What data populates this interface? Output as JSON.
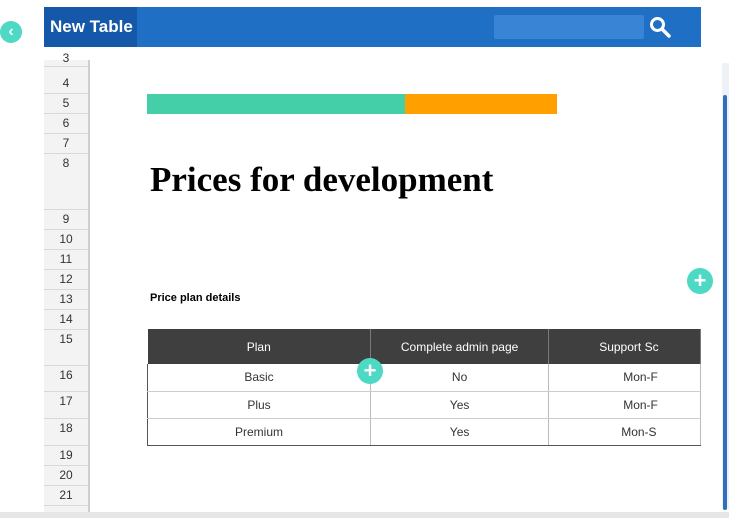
{
  "app": {
    "title": "New Table"
  },
  "search": {
    "placeholder": ""
  },
  "rows": [
    "3",
    "4",
    "5",
    "6",
    "7",
    "8",
    "9",
    "10",
    "11",
    "12",
    "13",
    "14",
    "15",
    "16",
    "17",
    "18",
    "19",
    "20",
    "21"
  ],
  "document": {
    "title": "Prices for development",
    "subtitle": "Price plan details",
    "accent_colors": {
      "green": "#45cfa9",
      "orange": "#ffa000",
      "header": "#1f6fc5"
    }
  },
  "table": {
    "headers": [
      "Plan",
      "Complete admin page",
      "Support Sc"
    ],
    "rows": [
      [
        "Basic",
        "No",
        "Mon-F"
      ],
      [
        "Plus",
        "Yes",
        "Mon-F"
      ],
      [
        "Premium",
        "Yes",
        "Mon-S"
      ]
    ]
  },
  "icons": {
    "back": "chevron-left-icon",
    "search": "search-icon",
    "add": "plus-icon"
  },
  "labels": {
    "plus": "+",
    "back": "‹"
  }
}
